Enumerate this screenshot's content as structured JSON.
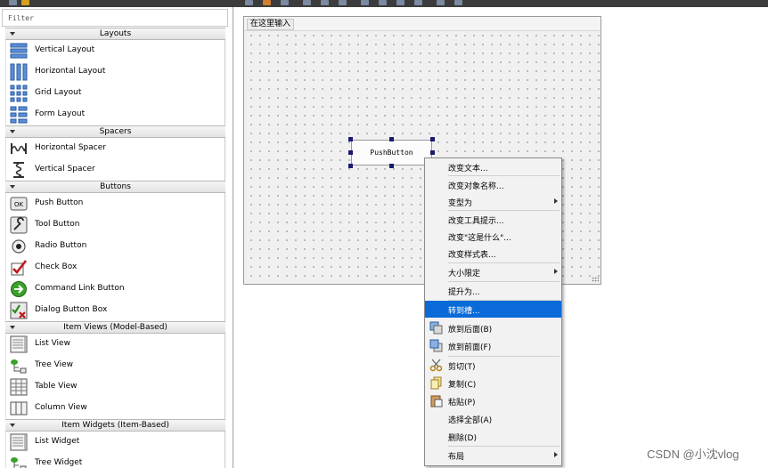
{
  "filter": {
    "placeholder": "Filter"
  },
  "categories": {
    "layouts": {
      "label": "Layouts",
      "items": [
        {
          "label": "Vertical Layout",
          "icon": "vertical-layout-icon"
        },
        {
          "label": "Horizontal Layout",
          "icon": "horizontal-layout-icon"
        },
        {
          "label": "Grid Layout",
          "icon": "grid-layout-icon"
        },
        {
          "label": "Form Layout",
          "icon": "form-layout-icon"
        }
      ]
    },
    "spacers": {
      "label": "Spacers",
      "items": [
        {
          "label": "Horizontal Spacer",
          "icon": "horizontal-spacer-icon"
        },
        {
          "label": "Vertical Spacer",
          "icon": "vertical-spacer-icon"
        }
      ]
    },
    "buttons": {
      "label": "Buttons",
      "items": [
        {
          "label": "Push Button",
          "icon": "push-button-icon",
          "icon_text": "OK"
        },
        {
          "label": "Tool Button",
          "icon": "tool-button-icon"
        },
        {
          "label": "Radio Button",
          "icon": "radio-button-icon"
        },
        {
          "label": "Check Box",
          "icon": "check-box-icon"
        },
        {
          "label": "Command Link Button",
          "icon": "command-link-icon"
        },
        {
          "label": "Dialog Button Box",
          "icon": "dialog-button-box-icon"
        }
      ]
    },
    "item_views": {
      "label": "Item Views (Model-Based)",
      "items": [
        {
          "label": "List View",
          "icon": "list-view-icon"
        },
        {
          "label": "Tree View",
          "icon": "tree-view-icon"
        },
        {
          "label": "Table View",
          "icon": "table-view-icon"
        },
        {
          "label": "Column View",
          "icon": "column-view-icon"
        }
      ]
    },
    "item_widgets": {
      "label": "Item Widgets (Item-Based)",
      "items": [
        {
          "label": "List Widget",
          "icon": "list-widget-icon"
        },
        {
          "label": "Tree Widget",
          "icon": "tree-widget-icon"
        }
      ]
    }
  },
  "form": {
    "menubar_placeholder": "在这里输入",
    "pushbutton_text": "PushButton"
  },
  "context_menu": [
    {
      "label": "改变文本..."
    },
    {
      "label": "改变对象名称..."
    },
    {
      "label": "变型为",
      "submenu": true
    },
    {
      "label": "改变工具提示..."
    },
    {
      "label": "改变\"这是什么\"..."
    },
    {
      "label": "改变样式表..."
    },
    {
      "label": "大小限定",
      "submenu": true
    },
    {
      "label": "提升为..."
    },
    {
      "label": "转到槽...",
      "highlighted": true
    },
    {
      "label": "放到后面(B)",
      "icon": "send-to-back-icon"
    },
    {
      "label": "放到前面(F)",
      "icon": "bring-to-front-icon"
    },
    {
      "label": "剪切(T)",
      "icon": "cut-icon"
    },
    {
      "label": "复制(C)",
      "icon": "copy-icon"
    },
    {
      "label": "粘贴(P)",
      "icon": "paste-icon"
    },
    {
      "label": "选择全部(A)"
    },
    {
      "label": "删除(D)"
    },
    {
      "label": "布局",
      "submenu": true
    }
  ],
  "watermark": "CSDN @小沈vlog",
  "colors": {
    "highlight": "#0a6ad8",
    "handle": "#1a1a6e"
  }
}
